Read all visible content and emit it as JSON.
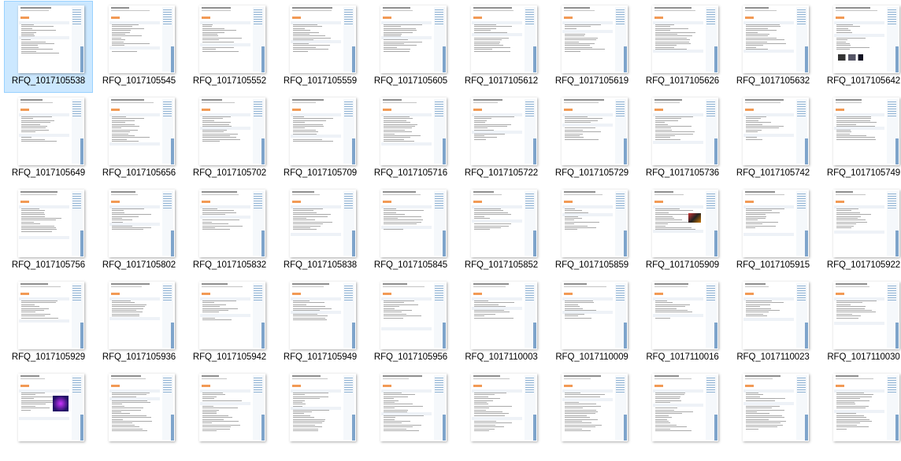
{
  "view": {
    "selected_file": "RFQ_1017105538",
    "rows": [
      [
        "RFQ_1017105538",
        "RFQ_1017105545",
        "RFQ_1017105552",
        "RFQ_1017105559",
        "RFQ_1017105605",
        "RFQ_1017105612",
        "RFQ_1017105619",
        "RFQ_1017105626",
        "RFQ_1017105632",
        "RFQ_1017105642"
      ],
      [
        "RFQ_1017105649",
        "RFQ_1017105656",
        "RFQ_1017105702",
        "RFQ_1017105709",
        "RFQ_1017105716",
        "RFQ_1017105722",
        "RFQ_1017105729",
        "RFQ_1017105736",
        "RFQ_1017105742",
        "RFQ_1017105749"
      ],
      [
        "RFQ_1017105756",
        "RFQ_1017105802",
        "RFQ_1017105832",
        "RFQ_1017105838",
        "RFQ_1017105845",
        "RFQ_1017105852",
        "RFQ_1017105859",
        "RFQ_1017105909",
        "RFQ_1017105915",
        "RFQ_1017105922"
      ],
      [
        "RFQ_1017105929",
        "RFQ_1017105936",
        "RFQ_1017105942",
        "RFQ_1017105949",
        "RFQ_1017105956",
        "RFQ_1017110003",
        "RFQ_1017110009",
        "RFQ_1017110016",
        "RFQ_1017110023",
        "RFQ_1017110030"
      ],
      [
        "",
        "",
        "",
        "",
        "",
        "",
        "",
        "",
        "",
        ""
      ]
    ]
  },
  "colors": {
    "selection_fill": "#cce8ff",
    "selection_border": "#99d1ff",
    "thumb_accent": "#f29a55",
    "thumb_sidebar": "#7ea4cb"
  },
  "icons": {
    "file_thumbnail": "document-thumbnail-icon"
  }
}
